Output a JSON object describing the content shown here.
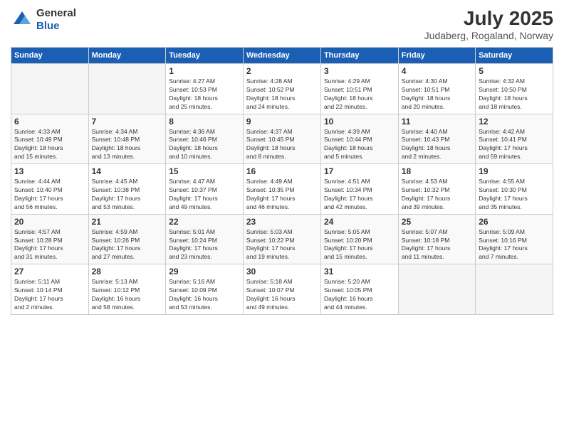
{
  "header": {
    "logo_general": "General",
    "logo_blue": "Blue",
    "month_year": "July 2025",
    "location": "Judaberg, Rogaland, Norway"
  },
  "weekdays": [
    "Sunday",
    "Monday",
    "Tuesday",
    "Wednesday",
    "Thursday",
    "Friday",
    "Saturday"
  ],
  "weeks": [
    [
      {
        "day": "",
        "info": ""
      },
      {
        "day": "",
        "info": ""
      },
      {
        "day": "1",
        "info": "Sunrise: 4:27 AM\nSunset: 10:53 PM\nDaylight: 18 hours\nand 25 minutes."
      },
      {
        "day": "2",
        "info": "Sunrise: 4:28 AM\nSunset: 10:52 PM\nDaylight: 18 hours\nand 24 minutes."
      },
      {
        "day": "3",
        "info": "Sunrise: 4:29 AM\nSunset: 10:51 PM\nDaylight: 18 hours\nand 22 minutes."
      },
      {
        "day": "4",
        "info": "Sunrise: 4:30 AM\nSunset: 10:51 PM\nDaylight: 18 hours\nand 20 minutes."
      },
      {
        "day": "5",
        "info": "Sunrise: 4:32 AM\nSunset: 10:50 PM\nDaylight: 18 hours\nand 18 minutes."
      }
    ],
    [
      {
        "day": "6",
        "info": "Sunrise: 4:33 AM\nSunset: 10:49 PM\nDaylight: 18 hours\nand 15 minutes."
      },
      {
        "day": "7",
        "info": "Sunrise: 4:34 AM\nSunset: 10:48 PM\nDaylight: 18 hours\nand 13 minutes."
      },
      {
        "day": "8",
        "info": "Sunrise: 4:36 AM\nSunset: 10:46 PM\nDaylight: 18 hours\nand 10 minutes."
      },
      {
        "day": "9",
        "info": "Sunrise: 4:37 AM\nSunset: 10:45 PM\nDaylight: 18 hours\nand 8 minutes."
      },
      {
        "day": "10",
        "info": "Sunrise: 4:39 AM\nSunset: 10:44 PM\nDaylight: 18 hours\nand 5 minutes."
      },
      {
        "day": "11",
        "info": "Sunrise: 4:40 AM\nSunset: 10:43 PM\nDaylight: 18 hours\nand 2 minutes."
      },
      {
        "day": "12",
        "info": "Sunrise: 4:42 AM\nSunset: 10:41 PM\nDaylight: 17 hours\nand 59 minutes."
      }
    ],
    [
      {
        "day": "13",
        "info": "Sunrise: 4:44 AM\nSunset: 10:40 PM\nDaylight: 17 hours\nand 56 minutes."
      },
      {
        "day": "14",
        "info": "Sunrise: 4:45 AM\nSunset: 10:38 PM\nDaylight: 17 hours\nand 53 minutes."
      },
      {
        "day": "15",
        "info": "Sunrise: 4:47 AM\nSunset: 10:37 PM\nDaylight: 17 hours\nand 49 minutes."
      },
      {
        "day": "16",
        "info": "Sunrise: 4:49 AM\nSunset: 10:35 PM\nDaylight: 17 hours\nand 46 minutes."
      },
      {
        "day": "17",
        "info": "Sunrise: 4:51 AM\nSunset: 10:34 PM\nDaylight: 17 hours\nand 42 minutes."
      },
      {
        "day": "18",
        "info": "Sunrise: 4:53 AM\nSunset: 10:32 PM\nDaylight: 17 hours\nand 39 minutes."
      },
      {
        "day": "19",
        "info": "Sunrise: 4:55 AM\nSunset: 10:30 PM\nDaylight: 17 hours\nand 35 minutes."
      }
    ],
    [
      {
        "day": "20",
        "info": "Sunrise: 4:57 AM\nSunset: 10:28 PM\nDaylight: 17 hours\nand 31 minutes."
      },
      {
        "day": "21",
        "info": "Sunrise: 4:59 AM\nSunset: 10:26 PM\nDaylight: 17 hours\nand 27 minutes."
      },
      {
        "day": "22",
        "info": "Sunrise: 5:01 AM\nSunset: 10:24 PM\nDaylight: 17 hours\nand 23 minutes."
      },
      {
        "day": "23",
        "info": "Sunrise: 5:03 AM\nSunset: 10:22 PM\nDaylight: 17 hours\nand 19 minutes."
      },
      {
        "day": "24",
        "info": "Sunrise: 5:05 AM\nSunset: 10:20 PM\nDaylight: 17 hours\nand 15 minutes."
      },
      {
        "day": "25",
        "info": "Sunrise: 5:07 AM\nSunset: 10:18 PM\nDaylight: 17 hours\nand 11 minutes."
      },
      {
        "day": "26",
        "info": "Sunrise: 5:09 AM\nSunset: 10:16 PM\nDaylight: 17 hours\nand 7 minutes."
      }
    ],
    [
      {
        "day": "27",
        "info": "Sunrise: 5:11 AM\nSunset: 10:14 PM\nDaylight: 17 hours\nand 2 minutes."
      },
      {
        "day": "28",
        "info": "Sunrise: 5:13 AM\nSunset: 10:12 PM\nDaylight: 16 hours\nand 58 minutes."
      },
      {
        "day": "29",
        "info": "Sunrise: 5:16 AM\nSunset: 10:09 PM\nDaylight: 16 hours\nand 53 minutes."
      },
      {
        "day": "30",
        "info": "Sunrise: 5:18 AM\nSunset: 10:07 PM\nDaylight: 16 hours\nand 49 minutes."
      },
      {
        "day": "31",
        "info": "Sunrise: 5:20 AM\nSunset: 10:05 PM\nDaylight: 16 hours\nand 44 minutes."
      },
      {
        "day": "",
        "info": ""
      },
      {
        "day": "",
        "info": ""
      }
    ]
  ]
}
